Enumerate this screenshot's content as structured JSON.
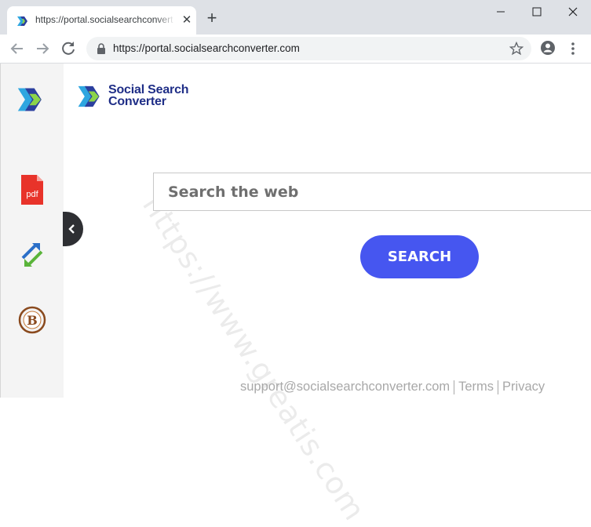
{
  "browser": {
    "tab_title": "https://portal.socialsearchconverter.com",
    "url": "https://portal.socialsearchconverter.com"
  },
  "logo": {
    "line1": "Social Search",
    "line2": "Converter"
  },
  "search": {
    "placeholder": "Search the web",
    "button_label": "SEARCH"
  },
  "watermark": "https://www.greatis.com",
  "footer": {
    "email": "support@socialsearchconverter.com",
    "terms": "Terms",
    "privacy": "Privacy"
  },
  "sidebar": {
    "pdf_label": "pdf"
  },
  "colors": {
    "brand_blue": "#1f2e87",
    "search_button": "#4656f0",
    "titlebar": "#dee1e6"
  }
}
